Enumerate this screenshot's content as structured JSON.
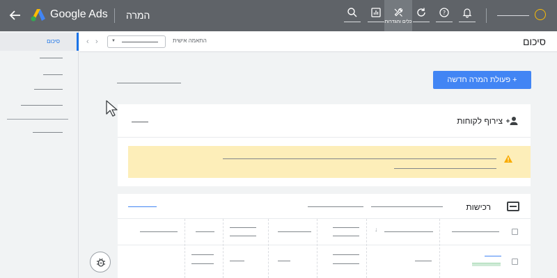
{
  "app": {
    "brand": "Google Ads",
    "page_title": "המרה"
  },
  "toolbar": {
    "active_tool_caption": "כלים והגדרות",
    "icons": [
      "search-icon",
      "reports-icon",
      "tools-icon",
      "refresh-icon",
      "help-icon",
      "notifications-icon"
    ]
  },
  "sidebar": {
    "active_item": "סיכום"
  },
  "filterbar": {
    "label": "התאמה אישית",
    "summary_title": "סיכום"
  },
  "main": {
    "new_action_button": "פעולת המרה חדשה +",
    "customer_card_title": "צירוף לקוחות",
    "purchases_card_title": "רכישות"
  },
  "colors": {
    "topbar": "#5f6368",
    "accent": "#4285f4",
    "alert_bg": "#fdeeb9",
    "warning": "#f9ab00"
  }
}
